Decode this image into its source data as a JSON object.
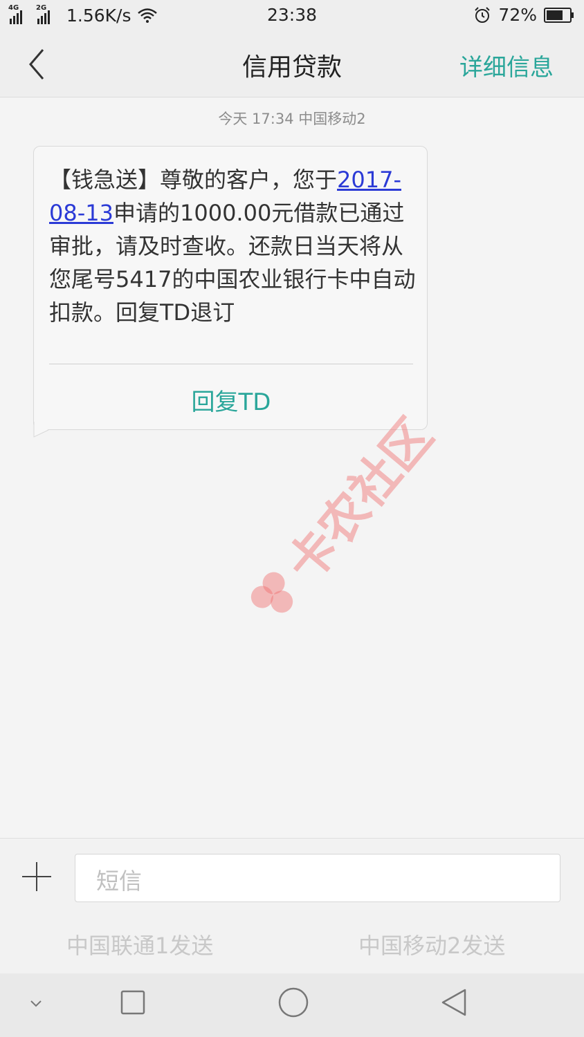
{
  "status_bar": {
    "sim1_network": "4G",
    "sim2_network": "2G",
    "speed": "1.56K/s",
    "time": "23:38",
    "battery_percent": "72%",
    "battery_level": 0.72
  },
  "header": {
    "title": "信用贷款",
    "detail_label": "详细信息"
  },
  "conversation": {
    "timestamp": "今天  17:34  中国移动2",
    "message": {
      "text_before": "【钱急送】尊敬的客户，您于",
      "date_link": "2017-08-13",
      "text_after": "申请的1000.00元借款已通过审批，请及时查收。还款日当天将从您尾号5417的中国农业银行卡中自动扣款。回复TD退订"
    },
    "quick_reply": "回复TD"
  },
  "watermark": {
    "text": "卡农社区"
  },
  "compose": {
    "placeholder": "短信",
    "send_sim1": "中国联通1发送",
    "send_sim2": "中国移动2发送"
  },
  "colors": {
    "accent": "#2aa69a",
    "link": "#2b3ad6"
  },
  "icons": {
    "back": "chevron-left-icon",
    "attach": "plus-icon",
    "nav_menu": "chevron-down-icon",
    "nav_recent": "square-icon",
    "nav_home": "circle-icon",
    "nav_back": "triangle-back-icon"
  }
}
